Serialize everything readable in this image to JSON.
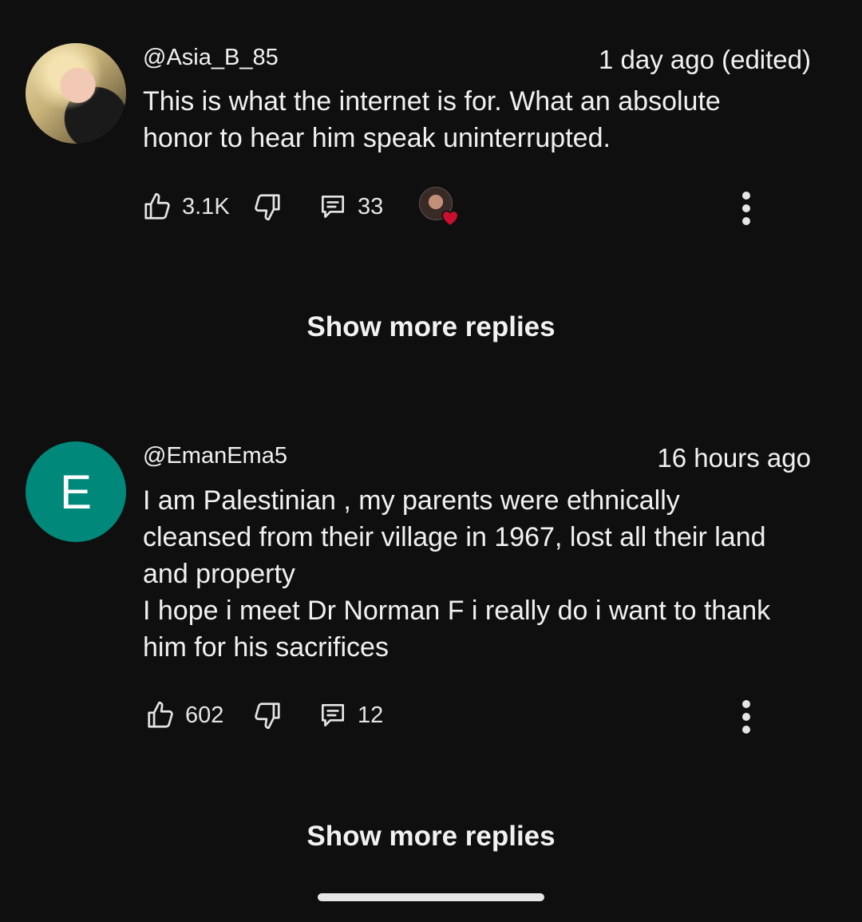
{
  "comments": [
    {
      "author": "@Asia_B_85",
      "time": "1 day ago (edited)",
      "text": "This is what the internet is for. What an absolute\nhonor to hear him speak uninterrupted.",
      "likes": "3.1K",
      "replies": "33",
      "avatar_icon": "profile-photo"
    },
    {
      "author": "@EmanEma5",
      "time": "16 hours ago",
      "text": "I am Palestinian , my parents were ethnically\ncleansed from their village in 1967, lost all their land\nand property\nI hope i meet Dr Norman F i really do i want to thank\nhim for his sacrifices",
      "likes": "602",
      "replies": "12",
      "avatar_letter": "E",
      "avatar_color": "#00897b"
    }
  ],
  "show_more_label": "Show more replies",
  "colors": {
    "background": "#0f0f0f",
    "text": "#f1f1f1",
    "heart": "#c8102e"
  }
}
